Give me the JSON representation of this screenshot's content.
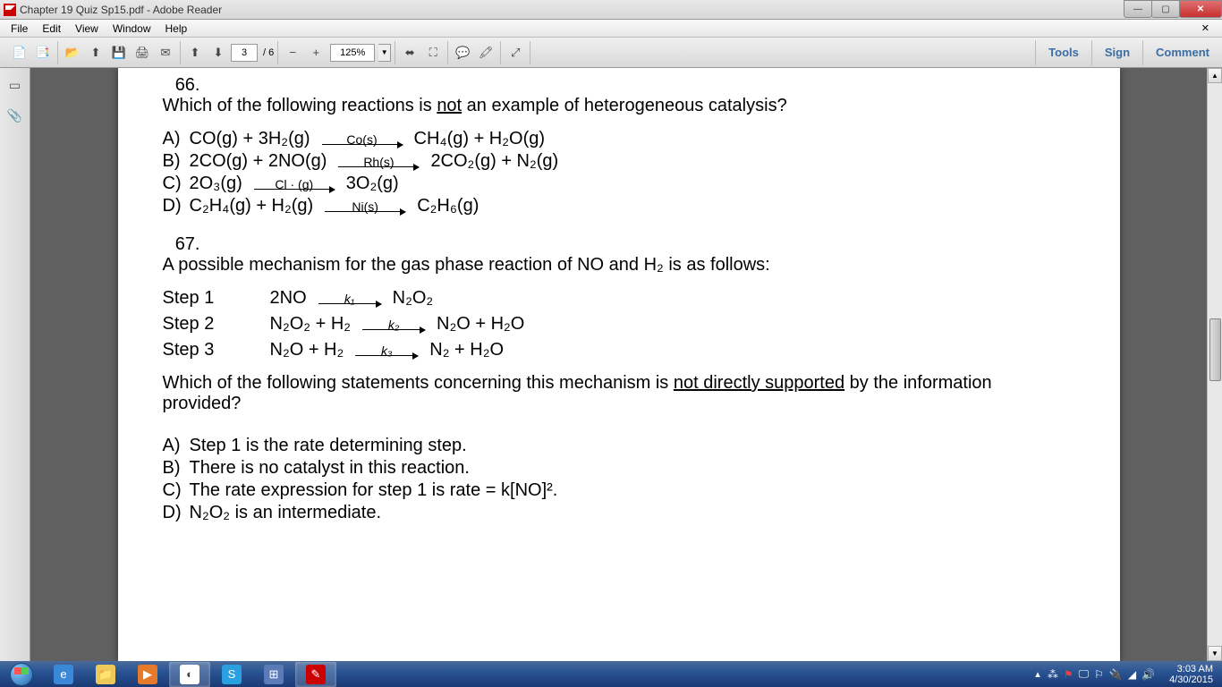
{
  "window": {
    "title": "Chapter 19 Quiz Sp15.pdf - Adobe Reader"
  },
  "menu": {
    "items": [
      "File",
      "Edit",
      "View",
      "Window",
      "Help"
    ]
  },
  "toolbar": {
    "page_current": "3",
    "page_total": "/ 6",
    "zoom": "125%",
    "right": {
      "tools": "Tools",
      "sign": "Sign",
      "comment": "Comment"
    }
  },
  "document": {
    "q66": {
      "number": "66.",
      "prompt_pre": "Which of the following reactions is ",
      "prompt_u": "not",
      "prompt_post": " an example of heterogeneous catalysis?",
      "options": [
        {
          "label": "A)",
          "lhs": "CO(g) + 3H₂(g)",
          "cat": "Co(s)",
          "rhs": "CH₄(g) + H₂O(g)"
        },
        {
          "label": "B)",
          "lhs": "2CO(g) + 2NO(g)",
          "cat": "Rh(s)",
          "rhs": "2CO₂(g) + N₂(g)"
        },
        {
          "label": "C)",
          "lhs": "2O₃(g)",
          "cat": "Cl · (g)",
          "rhs": "3O₂(g)"
        },
        {
          "label": "D)",
          "lhs": "C₂H₄(g) + H₂(g)",
          "cat": "Ni(s)",
          "rhs": "C₂H₆(g)"
        }
      ]
    },
    "q67": {
      "number": "67.",
      "prompt": "A possible mechanism for the gas phase reaction of NO and H₂ is as follows:",
      "steps": [
        {
          "label": "Step 1",
          "lhs": "2NO",
          "k": "k₁",
          "rhs": "N₂O₂"
        },
        {
          "label": "Step 2",
          "lhs": "N₂O₂ + H₂",
          "k": "k₂",
          "rhs": "N₂O + H₂O"
        },
        {
          "label": "Step 3",
          "lhs": "N₂O + H₂",
          "k": "k₃",
          "rhs": "N₂ + H₂O"
        }
      ],
      "follow_pre": "Which of the following statements concerning this mechanism is ",
      "follow_u": "not directly supported",
      "follow_post": " by the information provided?",
      "answers": [
        {
          "label": "A)",
          "text": "Step 1 is the rate determining step."
        },
        {
          "label": "B)",
          "text": "There is no catalyst in this reaction."
        },
        {
          "label": "C)",
          "text": "The rate expression for step 1 is rate = k[NO]²."
        },
        {
          "label": "D)",
          "text": "N₂O₂ is an intermediate."
        }
      ]
    }
  },
  "tray": {
    "time": "3:03 AM",
    "date": "4/30/2015"
  }
}
